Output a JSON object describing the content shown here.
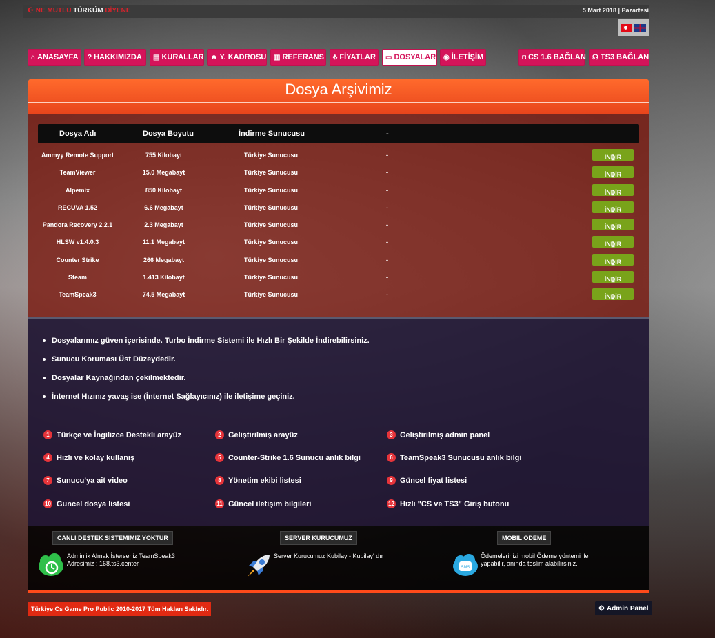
{
  "topbar": {
    "slogan_part1": "NE MUTLU",
    "slogan_part2": "TÜRKÜM",
    "slogan_part3": "DİYENE",
    "date": "5 Mart 2018 | Pazartesi"
  },
  "nav": [
    {
      "label": "ANASAYFA",
      "icon": "home-icon"
    },
    {
      "label": "HAKKIMIZDA",
      "icon": "question-icon"
    },
    {
      "label": "KURALLAR",
      "icon": "file-icon"
    },
    {
      "label": "Y. KADROSU",
      "icon": "users-icon"
    },
    {
      "label": "REFERANS",
      "icon": "chart-icon"
    },
    {
      "label": "FİYATLAR",
      "icon": "lira-icon"
    },
    {
      "label": "DOSYALAR",
      "icon": "folder-open-icon",
      "active": true
    },
    {
      "label": "İLETİŞİM",
      "icon": "map-marker-icon"
    }
  ],
  "connect": [
    {
      "label": "CS 1.6 BAĞLAN",
      "icon": "gamepad-icon"
    },
    {
      "label": "TS3 BAĞLAN",
      "icon": "headset-icon"
    }
  ],
  "archive": {
    "title": "Dosya Arşivimiz",
    "headers": [
      "Dosya Adı",
      "Dosya Boyutu",
      "İndirme Sunucusu",
      "-"
    ],
    "download_label": "İNDİR",
    "rows": [
      {
        "name": "Ammyy Remote Support",
        "size": "755 Kilobayt",
        "server": "Türkiye Sunucusu",
        "extra": "-"
      },
      {
        "name": "TeamViewer",
        "size": "15.0 Megabayt",
        "server": "Türkiye Sunucusu",
        "extra": "-"
      },
      {
        "name": "Alpemix",
        "size": "850 Kilobayt",
        "server": "Türkiye Sunucusu",
        "extra": "-"
      },
      {
        "name": "RECUVA 1.52",
        "size": "6.6 Megabayt",
        "server": "Türkiye Sunucusu",
        "extra": "-"
      },
      {
        "name": "Pandora Recovery 2.2.1",
        "size": "2.3 Megabayt",
        "server": "Türkiye Sunucusu",
        "extra": "-"
      },
      {
        "name": "HLSW v1.4.0.3",
        "size": "11.1 Megabayt",
        "server": "Türkiye Sunucusu",
        "extra": "-"
      },
      {
        "name": "Counter Strike",
        "size": "266 Megabayt",
        "server": "Türkiye Sunucusu",
        "extra": "-"
      },
      {
        "name": "Steam",
        "size": "1.413 Kilobayt",
        "server": "Türkiye Sunucusu",
        "extra": "-"
      },
      {
        "name": "TeamSpeak3",
        "size": "74.5 Megabayt",
        "server": "Türkiye Sunucusu",
        "extra": "-"
      }
    ]
  },
  "notes": [
    "Dosyalarımız güven içerisinde. Turbo İndirme Sistemi ile Hızlı Bir Şekilde İndirebilirsiniz.",
    "Sunucu Koruması Üst Düzeydedir.",
    "Dosyalar Kaynağından çekilmektedir.",
    "İnternet Hızınız yavaş ise (İnternet Sağlayıcınız) ile iletişime geçiniz."
  ],
  "features": [
    {
      "num": "1",
      "text": "Türkçe ve İngilizce Destekli arayüz"
    },
    {
      "num": "2",
      "text": "Geliştirilmiş arayüz"
    },
    {
      "num": "3",
      "text": "Geliştirilmiş admin panel"
    },
    {
      "num": "4",
      "text": "Hızlı ve kolay kullanış"
    },
    {
      "num": "5",
      "text": "Counter-Strike 1.6 Sunucu anlık bilgi"
    },
    {
      "num": "6",
      "text": "TeamSpeak3 Sunucusu anlık bilgi"
    },
    {
      "num": "7",
      "text": "Sunucu'ya ait video"
    },
    {
      "num": "8",
      "text": "Yönetim ekibi listesi"
    },
    {
      "num": "9",
      "text": "Güncel fiyat listesi"
    },
    {
      "num": "10",
      "text": "Guncel dosya listesi"
    },
    {
      "num": "11",
      "text": "Güncel iletişim bilgileri"
    },
    {
      "num": "12",
      "text": "Hızlı \"CS ve TS3\" Giriş butonu"
    }
  ],
  "footer": {
    "support_title": "CANLI DESTEK SİSTEMİMİZ YOKTUR",
    "support_text1": "Adminlik Almak İsterseniz TeamSpeak3",
    "support_text2": "Adresimiz : 168.ts3.center",
    "founder_title": "SERVER KURUCUMUZ",
    "founder_text": "Server Kurucumuz Kubilay - Kubilay' dır",
    "payment_title": "MOBİL ÖDEME",
    "payment_text1": "Ödemelerinizi mobil Ödeme yöntemi ile",
    "payment_text2": "yapabilir, anında teslim alabilirsiniz.",
    "copyright": "Türkiye Cs Game Pro Public 2010-2017 Tüm Hakları Saklıdır.",
    "admin_label": "Admin Panel"
  },
  "colors": {
    "nav_bg": "#d4145a",
    "panel_orange": "#ff6a2c",
    "download_green": "#79a31a",
    "feature_badge": "#e6343a"
  }
}
